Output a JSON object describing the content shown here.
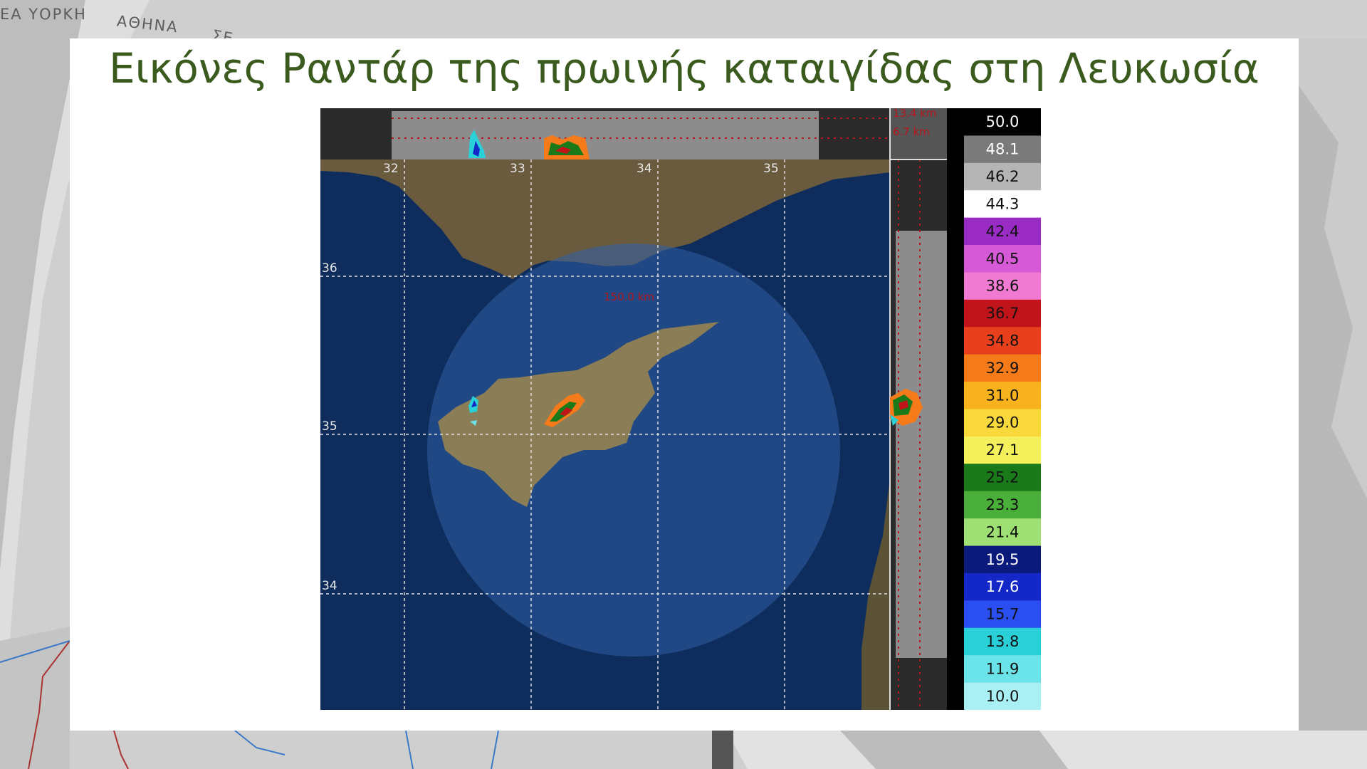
{
  "background": {
    "city_labels": [
      "ΕΑ ΥΟΡΚΗ",
      "ΑΘΗΝΑ",
      "ΣΕ"
    ]
  },
  "slide": {
    "title": "Εικόνες Ραντάρ της πρωινής καταιγίδας στη Λευκωσία"
  },
  "radar": {
    "longitude_labels": [
      "32",
      "33",
      "34",
      "35"
    ],
    "latitude_labels": [
      "36",
      "35",
      "34"
    ],
    "range_label": "150.0 km",
    "height_labels": [
      "13.4 km",
      "6.7 km"
    ],
    "scale": [
      {
        "value": "50.0",
        "color": "#000000",
        "dark": true
      },
      {
        "value": "48.1",
        "color": "#7a7a7a",
        "dark": true
      },
      {
        "value": "46.2",
        "color": "#b5b5b5",
        "dark": false
      },
      {
        "value": "44.3",
        "color": "#ffffff",
        "dark": false
      },
      {
        "value": "42.4",
        "color": "#9a2bc4",
        "dark": false
      },
      {
        "value": "40.5",
        "color": "#d65ad8",
        "dark": false
      },
      {
        "value": "38.6",
        "color": "#f07ad2",
        "dark": false
      },
      {
        "value": "36.7",
        "color": "#c0141a",
        "dark": false
      },
      {
        "value": "34.8",
        "color": "#e8401c",
        "dark": false
      },
      {
        "value": "32.9",
        "color": "#f57a1a",
        "dark": false
      },
      {
        "value": "31.0",
        "color": "#f8b21e",
        "dark": false
      },
      {
        "value": "29.0",
        "color": "#f8d83a",
        "dark": false
      },
      {
        "value": "27.1",
        "color": "#f4f05c",
        "dark": false
      },
      {
        "value": "25.2",
        "color": "#1a7a1a",
        "dark": false
      },
      {
        "value": "23.3",
        "color": "#4aae3a",
        "dark": false
      },
      {
        "value": "21.4",
        "color": "#9ee074",
        "dark": false
      },
      {
        "value": "19.5",
        "color": "#0a1a7a",
        "dark": true
      },
      {
        "value": "17.6",
        "color": "#1428c8",
        "dark": true
      },
      {
        "value": "15.7",
        "color": "#2a4ef0",
        "dark": false
      },
      {
        "value": "13.8",
        "color": "#2ad0d8",
        "dark": false
      },
      {
        "value": "11.9",
        "color": "#6ae4e8",
        "dark": false
      },
      {
        "value": "10.0",
        "color": "#a8f0f4",
        "dark": false
      }
    ]
  }
}
